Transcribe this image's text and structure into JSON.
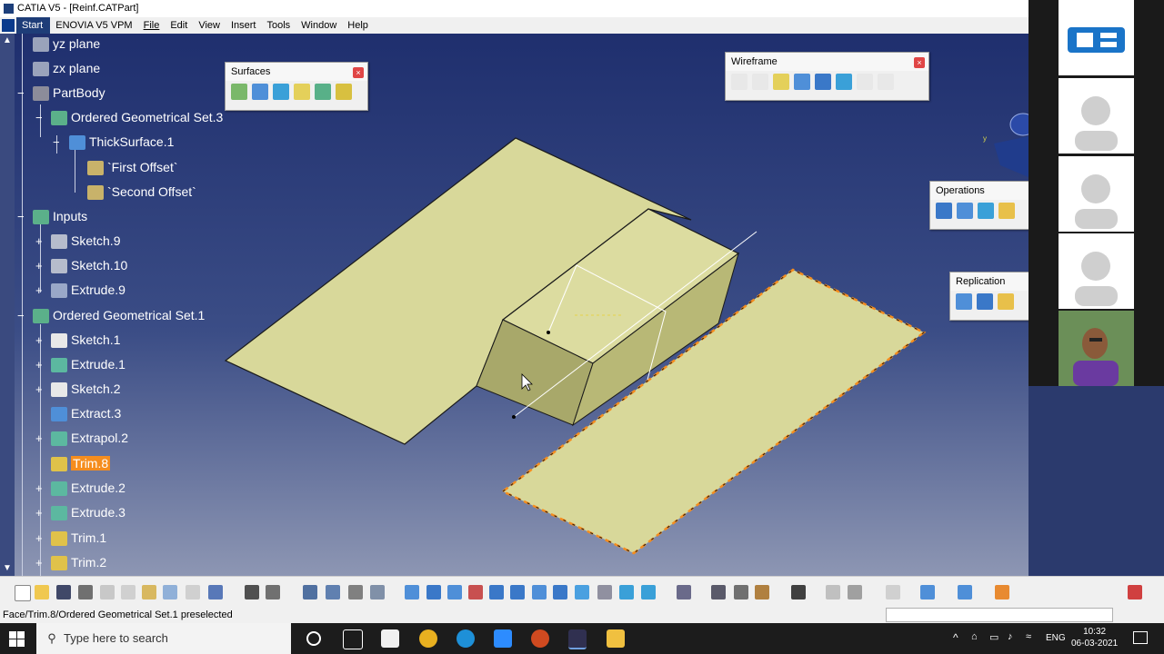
{
  "window": {
    "title": "CATIA V5 - [Reinf.CATPart]"
  },
  "menu": [
    "Start",
    "ENOVIA V5 VPM",
    "File",
    "Edit",
    "View",
    "Insert",
    "Tools",
    "Window",
    "Help"
  ],
  "tree": {
    "nodes": [
      {
        "label": "yz plane"
      },
      {
        "label": "zx plane"
      },
      {
        "label": "PartBody"
      },
      {
        "label": "Ordered Geometrical Set.3"
      },
      {
        "label": "ThickSurface.1"
      },
      {
        "label": "`First Offset`"
      },
      {
        "label": "`Second Offset`"
      },
      {
        "label": "Inputs"
      },
      {
        "label": "Sketch.9"
      },
      {
        "label": "Sketch.10"
      },
      {
        "label": "Extrude.9"
      },
      {
        "label": "Ordered Geometrical Set.1"
      },
      {
        "label": "Sketch.1"
      },
      {
        "label": "Extrude.1"
      },
      {
        "label": "Sketch.2"
      },
      {
        "label": "Extract.3"
      },
      {
        "label": "Extrapol.2"
      },
      {
        "label": "Trim.8"
      },
      {
        "label": "Extrude.2"
      },
      {
        "label": "Extrude.3"
      },
      {
        "label": "Trim.1"
      },
      {
        "label": "Trim.2"
      }
    ]
  },
  "toolbars": {
    "surfaces": {
      "title": "Surfaces",
      "close": "×"
    },
    "wireframe": {
      "title": "Wireframe",
      "close": "×"
    },
    "operations": {
      "title": "Operations"
    },
    "replication": {
      "title": "Replication"
    }
  },
  "status": {
    "text": "Face/Trim.8/Ordered Geometrical Set.1 preselected"
  },
  "taskbar": {
    "search_placeholder": "Type here to search",
    "language": "ENG",
    "time": "10:32",
    "date": "06-03-2021"
  },
  "colors": {
    "surface": "#d8d89a",
    "surface_edge": "#1a1a1a",
    "highlight": "#f58d1e",
    "tree_text": "#ffffff"
  }
}
